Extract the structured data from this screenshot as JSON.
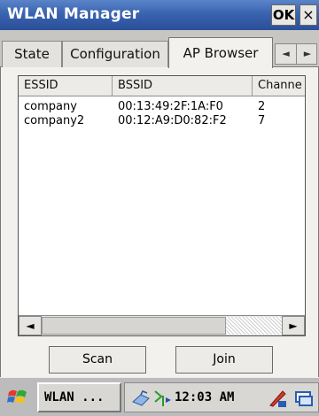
{
  "window": {
    "title": "WLAN Manager",
    "ok_label": "OK",
    "close_label": "×"
  },
  "tabs": [
    {
      "label": "State",
      "selected": false
    },
    {
      "label": "Configuration",
      "selected": false
    },
    {
      "label": "AP Browser",
      "selected": true
    }
  ],
  "tab_scroll": {
    "left_icon": "chevron-left-icon",
    "right_icon": "chevron-right-icon",
    "left_glyph": "◄",
    "right_glyph": "►"
  },
  "list": {
    "columns": [
      "ESSID",
      "BSSID",
      "Channe"
    ],
    "rows": [
      {
        "essid": "company",
        "bssid": "00:13:49:2F:1A:F0",
        "channel": "2"
      },
      {
        "essid": "company2",
        "bssid": "00:12:A9:D0:82:F2",
        "channel": "7"
      }
    ],
    "scroll_left_glyph": "◄",
    "scroll_right_glyph": "►"
  },
  "buttons": {
    "scan_label": "Scan",
    "join_label": "Join"
  },
  "taskbar": {
    "app_label": "WLAN ...",
    "clock": "12:03 AM",
    "colors": {
      "titlebar": "#3a63b0",
      "taskbar": "#bcbcbc"
    }
  }
}
